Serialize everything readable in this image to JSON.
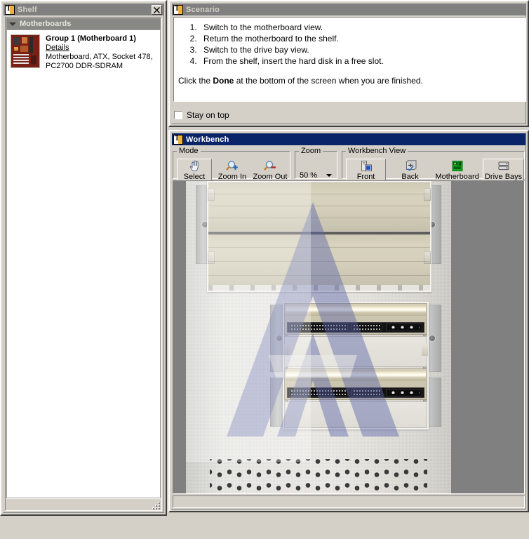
{
  "shelf": {
    "title": "Shelf",
    "close_label": "Close",
    "group_header": "Motherboards",
    "items": [
      {
        "name": "Group 1 (Motherboard 1)",
        "details_link": "Details",
        "description_line1": "Motherboard, ATX, Socket 478,",
        "description_line2": "PC2700 DDR-SDRAM",
        "thumbnail": "motherboard-thumbnail"
      }
    ]
  },
  "scenario": {
    "title": "Scenario",
    "steps": [
      "Switch to the motherboard view.",
      "Return the motherboard to the shelf.",
      "Switch to the drive bay view.",
      "From the shelf, insert the hard disk in a free slot."
    ],
    "closing_before": "Click the ",
    "closing_bold": "Done",
    "closing_after": " at the bottom of the screen when you are finished.",
    "stay_on_top_label": "Stay on top",
    "stay_on_top_checked": false
  },
  "workbench": {
    "title": "Workbench",
    "mode_group_label": "Mode",
    "mode_buttons": [
      {
        "label": "Select",
        "icon": "hand-pointer-icon",
        "selected": true
      },
      {
        "label": "Zoom In",
        "icon": "magnifier-plus-icon",
        "selected": false
      },
      {
        "label": "Zoom Out",
        "icon": "magnifier-minus-icon",
        "selected": false
      }
    ],
    "zoom_group_label": "Zoom",
    "zoom_value": "50 %",
    "view_group_label": "Workbench View",
    "view_buttons": [
      {
        "label": "Front",
        "icon": "pc-front-icon",
        "selected": false
      },
      {
        "label": "Back",
        "icon": "pc-back-icon",
        "selected": false
      },
      {
        "label": "Motherboard",
        "icon": "motherboard-icon",
        "selected": false
      },
      {
        "label": "Drive Bays",
        "icon": "drive-bays-icon",
        "selected": true
      }
    ],
    "canvas": {
      "view": "drive-bays",
      "background_color": "#808080",
      "case_description": "open computer case drive bay area",
      "bays": [
        {
          "type": "5.25-blank"
        },
        {
          "type": "5.25-blank"
        },
        {
          "type": "hard-disk"
        },
        {
          "type": "empty-slot"
        },
        {
          "type": "hard-disk"
        },
        {
          "type": "empty-slot"
        }
      ],
      "watermark": "chevron-a-logo"
    },
    "status_text": ""
  },
  "colors": {
    "active_titlebar": "#0a246a",
    "inactive_titlebar": "#808080",
    "window_face": "#d4d0c8",
    "canvas_backdrop": "#808080",
    "group_header": "#888884"
  }
}
